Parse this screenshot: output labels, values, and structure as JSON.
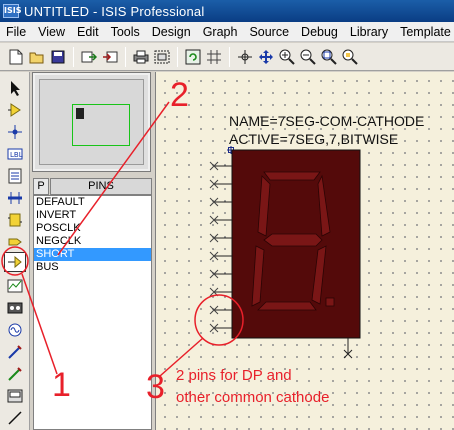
{
  "window": {
    "title": "UNTITLED - ISIS Professional",
    "app_icon_text": "ISIS"
  },
  "menu": [
    "File",
    "View",
    "Edit",
    "Tools",
    "Design",
    "Graph",
    "Source",
    "Debug",
    "Library",
    "Template"
  ],
  "toolbar_icons": [
    "new-file-icon",
    "open-file-icon",
    "save-icon",
    "import-icon",
    "export-icon",
    "print-icon",
    "print-area-icon",
    "refresh-icon",
    "grid-icon",
    "origin-icon",
    "pan-icon",
    "zoom-in-icon",
    "zoom-out-icon",
    "zoom-all-icon",
    "zoom-area-icon"
  ],
  "left_tools": [
    "selection-icon",
    "component-icon",
    "junction-dot-icon",
    "wire-label-icon",
    "text-script-icon",
    "buses-icon",
    "subcircuit-icon",
    "terminals-icon",
    "device-pins-icon",
    "graph-icon",
    "tape-recorder-icon",
    "generator-icon",
    "voltage-probe-icon",
    "current-probe-icon",
    "virtual-instruments-icon",
    "line-icon"
  ],
  "selector": {
    "mode_button": "P",
    "title": "PINS"
  },
  "pins": [
    "DEFAULT",
    "INVERT",
    "POSCLK",
    "NEGCLK",
    "SHORT",
    "BUS"
  ],
  "selected_pin": "SHORT",
  "component": {
    "name_label": "NAME=7SEG-COM-CATHODE",
    "active_label": "ACTIVE=7SEG,7,BITWISE"
  },
  "annotations": {
    "label_1": "1",
    "label_2": "2",
    "label_3": "3",
    "note_line1": "2 pins for DP and",
    "note_line2": "other common cathode",
    "color": "#e8202a"
  }
}
